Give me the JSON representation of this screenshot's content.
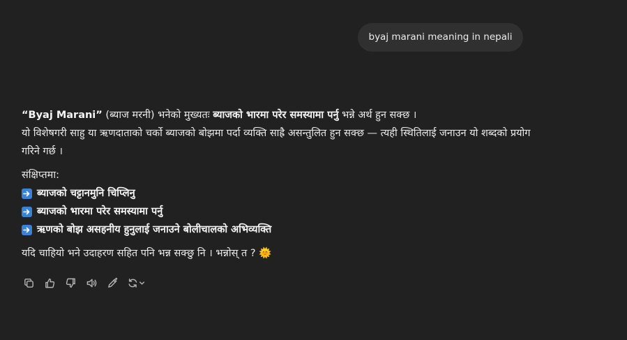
{
  "user_message": "byaj marani meaning in nepali",
  "answer": {
    "p1": {
      "lead": "“Byaj Marani”",
      "lead_rest": " (ब्याज मरनी) भनेको मुख्यतः ",
      "bold": "ब्याजको भारमा परेर समस्यामा पर्नु",
      "tail": " भन्ने अर्थ हुन सक्छ ।"
    },
    "p2": "यो विशेषगरी साहु या ऋणदाताको चर्को ब्याजको बोझमा पर्दा व्यक्ति साह्रै असन्तुलित हुन सक्छ — त्यही स्थितिलाई जनाउन यो शब्दको प्रयोग गरिने गर्छ ।",
    "summary_label": "संक्षिप्तमा:",
    "bullets": [
      "ब्याजको चट्टानमुनि चिप्लिनु",
      "ब्याजको भारमा परेर समस्यामा पर्नु",
      "ऋणको बोझ असहनीय हुनुलाई जनाउने बोलीचालको अभिव्यक्ति"
    ],
    "closing": "यदि चाहियो भने उदाहरण सहित पनि भन्न सक्छु नि । भन्नोस् त ?",
    "closing_emoji": "🌞"
  },
  "action_icons": [
    "copy-icon",
    "thumbs-up-icon",
    "thumbs-down-icon",
    "read-aloud-icon",
    "edit-icon",
    "regenerate-icon"
  ],
  "colors": {
    "background": "#212121",
    "bubble": "#303030",
    "text": "#ececec",
    "icon": "#b4b4b4",
    "arrow_badge": "#3b82d6"
  }
}
